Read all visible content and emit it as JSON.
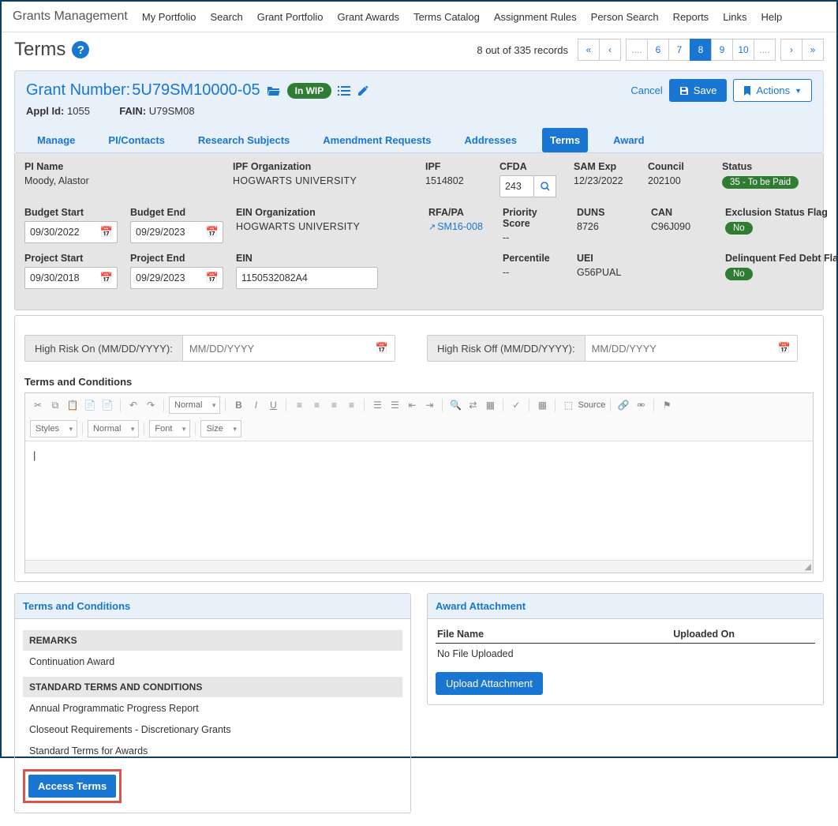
{
  "nav": {
    "brand": "Grants Management",
    "items": [
      "My Portfolio",
      "Search",
      "Grant Portfolio",
      "Grant Awards",
      "Terms Catalog",
      "Assignment Rules",
      "Person Search",
      "Reports",
      "Links",
      "Help"
    ]
  },
  "page": {
    "title": "Terms",
    "records_text": "8 out of 335 records",
    "pager": [
      "....",
      "6",
      "7",
      "8",
      "9",
      "10",
      "...."
    ],
    "pager_active": "8"
  },
  "grant": {
    "number_prefix": "Grant Number: ",
    "number": "5U79SM10000-05",
    "wip": "In WIP",
    "appl_id_label": "Appl Id:",
    "appl_id": "1055",
    "fain_label": "FAIN:",
    "fain": "U79SM08"
  },
  "actions": {
    "cancel": "Cancel",
    "save": "Save",
    "actions": "Actions"
  },
  "tabs": [
    "Manage",
    "PI/Contacts",
    "Research Subjects",
    "Amendment Requests",
    "Addresses",
    "Terms",
    "Award"
  ],
  "active_tab": "Terms",
  "info": {
    "pi_label": "PI Name",
    "pi": "Moody, Alastor",
    "ipf_org_label": "IPF Organization",
    "org_line": "HOGWARTS  UNIVERSITY",
    "ipf_label": "IPF",
    "ipf": "1514802",
    "cfda_label": "CFDA",
    "cfda": "243",
    "sam_label": "SAM Exp",
    "sam": "12/23/2022",
    "council_label": "Council",
    "council": "202100",
    "status_label": "Status",
    "status": "35 - To be Paid",
    "budget_start_label": "Budget Start",
    "budget_start": "09/30/2022",
    "budget_end_label": "Budget End",
    "budget_end": "09/29/2023",
    "ein_org_label": "EIN Organization",
    "rfapa_label": "RFA/PA",
    "rfapa": "SM16-008",
    "priority_label": "Priority Score",
    "priority": "--",
    "duns_label": "DUNS",
    "duns": "8726",
    "can_label": "CAN",
    "can": "C96J090",
    "excl_label": "Exclusion Status Flag",
    "excl": "No",
    "proj_start_label": "Project Start",
    "proj_start": "09/30/2018",
    "proj_end_label": "Project End",
    "proj_end": "09/29/2023",
    "ein_label": "EIN",
    "ein": "1150532082A4",
    "percentile_label": "Percentile",
    "percentile": "--",
    "uei_label": "UEI",
    "uei": "G56PUAL",
    "delinquent_label": "Delinquent Fed Debt Flag",
    "delinquent": "No"
  },
  "risk": {
    "on_label": "High Risk On (MM/DD/YYYY):",
    "off_label": "High Risk Off (MM/DD/YYYY):",
    "placeholder": "MM/DD/YYYY"
  },
  "rte": {
    "label": "Terms and Conditions",
    "styles": "Styles",
    "normal": "Normal",
    "font": "Font",
    "size": "Size",
    "source": "Source",
    "body": "|"
  },
  "tc_panel": {
    "title": "Terms and Conditions",
    "remarks_h": "REMARKS",
    "remarks_item": "Continuation Award",
    "std_h": "STANDARD TERMS AND CONDITIONS",
    "std_items": [
      "Annual Programmatic Progress Report",
      "Closeout Requirements - Discretionary Grants",
      "Standard Terms for Awards"
    ],
    "access": "Access Terms"
  },
  "attach_panel": {
    "title": "Award Attachment",
    "col1": "File Name",
    "col2": "Uploaded On",
    "empty": "No File Uploaded",
    "upload": "Upload Attachment"
  }
}
